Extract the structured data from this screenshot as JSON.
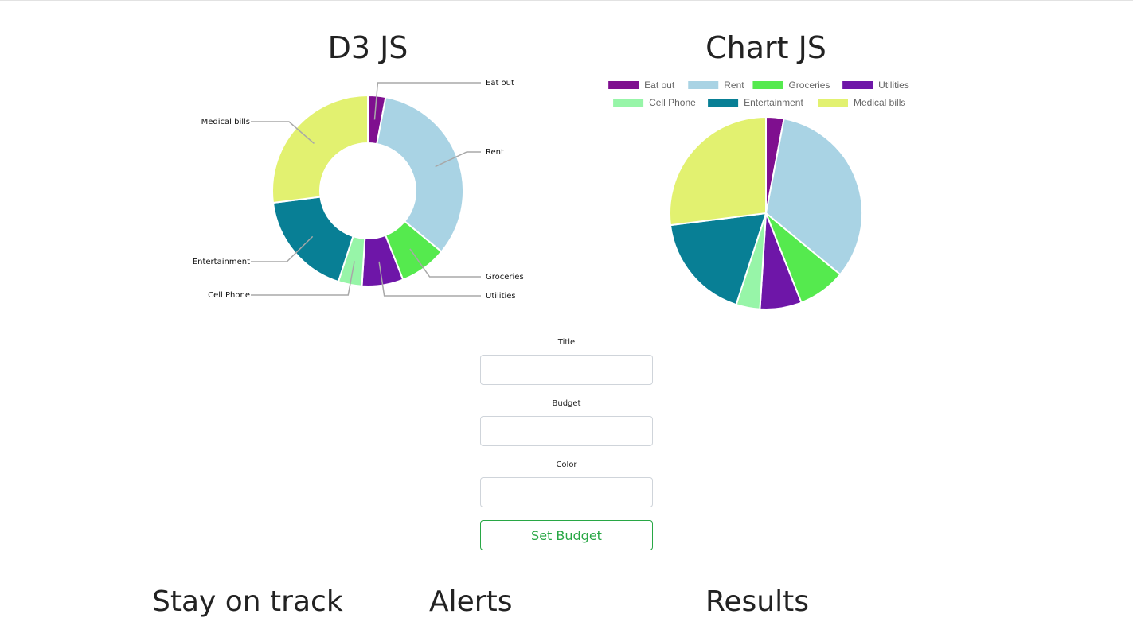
{
  "chart_data": [
    {
      "type": "pie",
      "variant": "donut",
      "title": "D3 JS",
      "categories": [
        "Eat out",
        "Rent",
        "Groceries",
        "Utilities",
        "Cell Phone",
        "Entertainment",
        "Medical bills"
      ],
      "values": [
        3,
        33,
        8,
        7,
        4,
        18,
        27
      ],
      "colors": [
        "#7f0f8f",
        "#a9d3e4",
        "#55ea4e",
        "#6e16a8",
        "#97f5a8",
        "#087f95",
        "#e2f170"
      ],
      "labels": "outside with leader lines",
      "legend": "none"
    },
    {
      "type": "pie",
      "title": "Chart JS",
      "categories": [
        "Eat out",
        "Rent",
        "Groceries",
        "Utilities",
        "Cell Phone",
        "Entertainment",
        "Medical bills"
      ],
      "values": [
        3,
        33,
        8,
        7,
        4,
        18,
        27
      ],
      "colors": [
        "#7f0f8f",
        "#a9d3e4",
        "#55ea4e",
        "#6e16a8",
        "#97f5a8",
        "#087f95",
        "#e2f170"
      ],
      "legend": "top"
    }
  ],
  "form": {
    "title_label": "Title",
    "budget_label": "Budget",
    "color_label": "Color",
    "title_value": "",
    "budget_value": "",
    "color_value": "",
    "submit_label": "Set Budget"
  },
  "sections": {
    "stay_on_track": "Stay on track",
    "alerts": "Alerts",
    "results": "Results"
  }
}
